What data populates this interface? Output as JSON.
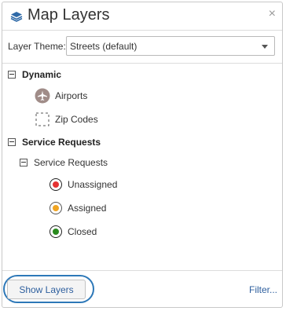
{
  "header": {
    "title": "Map Layers",
    "close_label": "×"
  },
  "theme": {
    "label": "Layer Theme:",
    "selected": "Streets (default)"
  },
  "tree": {
    "groups": [
      {
        "label": "Dynamic",
        "items": [
          {
            "label": "Airports",
            "icon": "airplane-icon"
          },
          {
            "label": "Zip Codes",
            "icon": "dashed-box-icon"
          }
        ]
      },
      {
        "label": "Service Requests",
        "subgroup": {
          "label": "Service Requests",
          "items": [
            {
              "label": "Unassigned",
              "color": "#e53232"
            },
            {
              "label": "Assigned",
              "color": "#f0a422"
            },
            {
              "label": "Closed",
              "color": "#2a8a1e"
            }
          ]
        }
      }
    ]
  },
  "footer": {
    "show_layers": "Show Layers",
    "filter": "Filter..."
  }
}
